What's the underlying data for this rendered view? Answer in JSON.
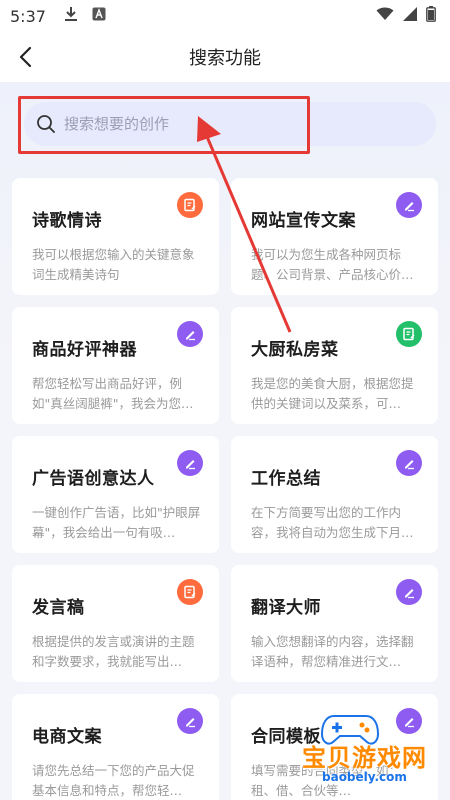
{
  "status_bar": {
    "time": "5:37"
  },
  "header": {
    "title": "搜索功能"
  },
  "search": {
    "placeholder": "搜索想要的创作",
    "value": ""
  },
  "cards": [
    {
      "title": "诗歌情诗",
      "desc": "我可以根据您输入的关键意象词生成精美诗句",
      "icon": "note-icon",
      "color": "#ff6b3d"
    },
    {
      "title": "网站宣传文案",
      "desc": "我可以为您生成各种网页标题、公司背景、产品核心价…",
      "icon": "pen-icon",
      "color": "#8e5cf0"
    },
    {
      "title": "商品好评神器",
      "desc": "帮您轻松写出商品好评，例如\"真丝阔腿裤\"，我会为您…",
      "icon": "pen-icon",
      "color": "#8e5cf0"
    },
    {
      "title": "大厨私房菜",
      "desc": "我是您的美食大厨，根据您提供的关键词以及菜系，可…",
      "icon": "note-icon",
      "color": "#22c06a"
    },
    {
      "title": "广告语创意达人",
      "desc": "一键创作广告语，比如\"护眼屏幕\"，我会给出一句有吸…",
      "icon": "pen-icon",
      "color": "#8e5cf0"
    },
    {
      "title": "工作总结",
      "desc": "在下方简要写出您的工作内容，我将自动为您生成下月…",
      "icon": "pen-icon",
      "color": "#8e5cf0"
    },
    {
      "title": "发言稿",
      "desc": "根据提供的发言或演讲的主题和字数要求，我就能写出…",
      "icon": "note-icon",
      "color": "#ff6b3d"
    },
    {
      "title": "翻译大师",
      "desc": "输入您想翻译的内容，选择翻译语种，帮您精准进行文…",
      "icon": "pen-icon",
      "color": "#8e5cf0"
    },
    {
      "title": "电商文案",
      "desc": "请您先总结一下您的产品大促基本信息和特点，帮您轻…",
      "icon": "pen-icon",
      "color": "#8e5cf0"
    },
    {
      "title": "合同模板",
      "desc": "填写需要的合同类型，如：租、借、合伙等…",
      "icon": "pen-icon",
      "color": "#8e5cf0"
    }
  ],
  "watermark": {
    "text": "宝贝游戏网",
    "url": "baobely.com"
  },
  "colors": {
    "highlight": "#e53935",
    "accent_purple": "#8e5cf0",
    "accent_orange": "#ff6b3d",
    "accent_green": "#22c06a"
  }
}
